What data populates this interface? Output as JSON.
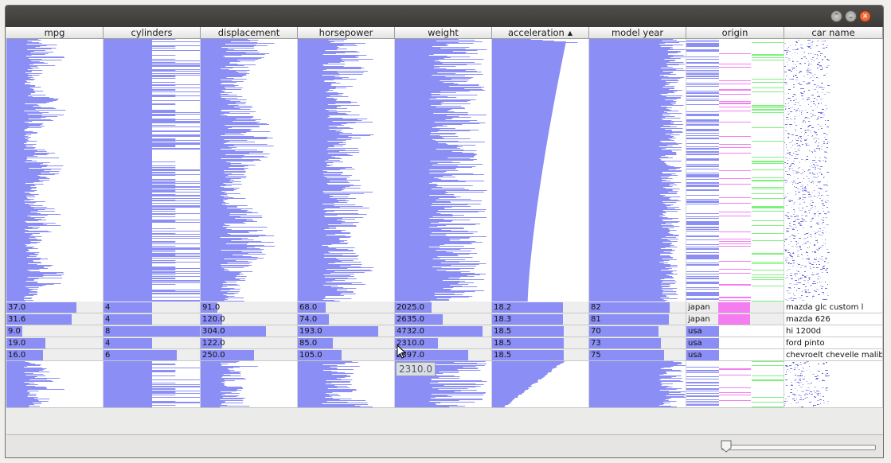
{
  "window": {
    "buttons": [
      "minimize-icon",
      "maximize-icon",
      "close-icon"
    ]
  },
  "colors": {
    "bar": "#8a8ef5",
    "origin_usa": "#8a8ef5",
    "origin_japan": "#f47ef0",
    "origin_europe": "#7ef07e",
    "sort_active": "#888888"
  },
  "columns": [
    {
      "label": "mpg"
    },
    {
      "label": "cylinders"
    },
    {
      "label": "displacement"
    },
    {
      "label": "horsepower"
    },
    {
      "label": "weight"
    },
    {
      "label": "acceleration",
      "sorted": "ascending",
      "sort_icon": "sort-up-icon"
    },
    {
      "label": "model year"
    },
    {
      "label": "origin"
    },
    {
      "label": "car name"
    }
  ],
  "focus_rows": [
    {
      "mpg": "37.0",
      "cylinders": "4",
      "displacement": "91.0",
      "horsepower": "68.0",
      "weight": "2025.0",
      "acceleration": "18.2",
      "model_year": "82",
      "origin": "japan",
      "car_name": "mazda glc custom l",
      "levels": {
        "mpg": 0.72,
        "cylinders": 0.5,
        "displacement": 0.17,
        "horsepower": 0.29,
        "weight": 0.38,
        "acceleration": 0.73,
        "model_year": 0.83
      }
    },
    {
      "mpg": "31.6",
      "cylinders": "4",
      "displacement": "120.0",
      "horsepower": "74.0",
      "weight": "2635.0",
      "acceleration": "18.3",
      "model_year": "81",
      "origin": "japan",
      "car_name": "mazda 626",
      "levels": {
        "mpg": 0.67,
        "cylinders": 0.5,
        "displacement": 0.22,
        "horsepower": 0.32,
        "weight": 0.49,
        "acceleration": 0.73,
        "model_year": 0.82
      }
    },
    {
      "mpg": "9.0",
      "cylinders": "8",
      "displacement": "304.0",
      "horsepower": "193.0",
      "weight": "4732.0",
      "acceleration": "18.5",
      "model_year": "70",
      "origin": "usa",
      "car_name": "hi 1200d",
      "levels": {
        "mpg": 0.16,
        "cylinders": 1.0,
        "displacement": 0.67,
        "horsepower": 0.83,
        "weight": 0.9,
        "acceleration": 0.74,
        "model_year": 0.71
      }
    },
    {
      "mpg": "19.0",
      "cylinders": "4",
      "displacement": "122.0",
      "horsepower": "85.0",
      "weight": "2310.0",
      "acceleration": "18.5",
      "model_year": "73",
      "origin": "usa",
      "car_name": "ford pinto",
      "levels": {
        "mpg": 0.4,
        "cylinders": 0.5,
        "displacement": 0.22,
        "horsepower": 0.36,
        "weight": 0.44,
        "acceleration": 0.74,
        "model_year": 0.74
      }
    },
    {
      "mpg": "16.0",
      "cylinders": "6",
      "displacement": "250.0",
      "horsepower": "105.0",
      "weight": "3897.0",
      "acceleration": "18.5",
      "model_year": "75",
      "origin": "usa",
      "car_name": "chevroelt chevelle malibu",
      "levels": {
        "mpg": 0.38,
        "cylinders": 0.75,
        "displacement": 0.55,
        "horsepower": 0.45,
        "weight": 0.75,
        "acceleration": 0.74,
        "model_year": 0.77
      }
    }
  ],
  "tooltip": {
    "text": "2310.0"
  },
  "statusbar": {
    "zoom_slider_level": 0.03
  }
}
